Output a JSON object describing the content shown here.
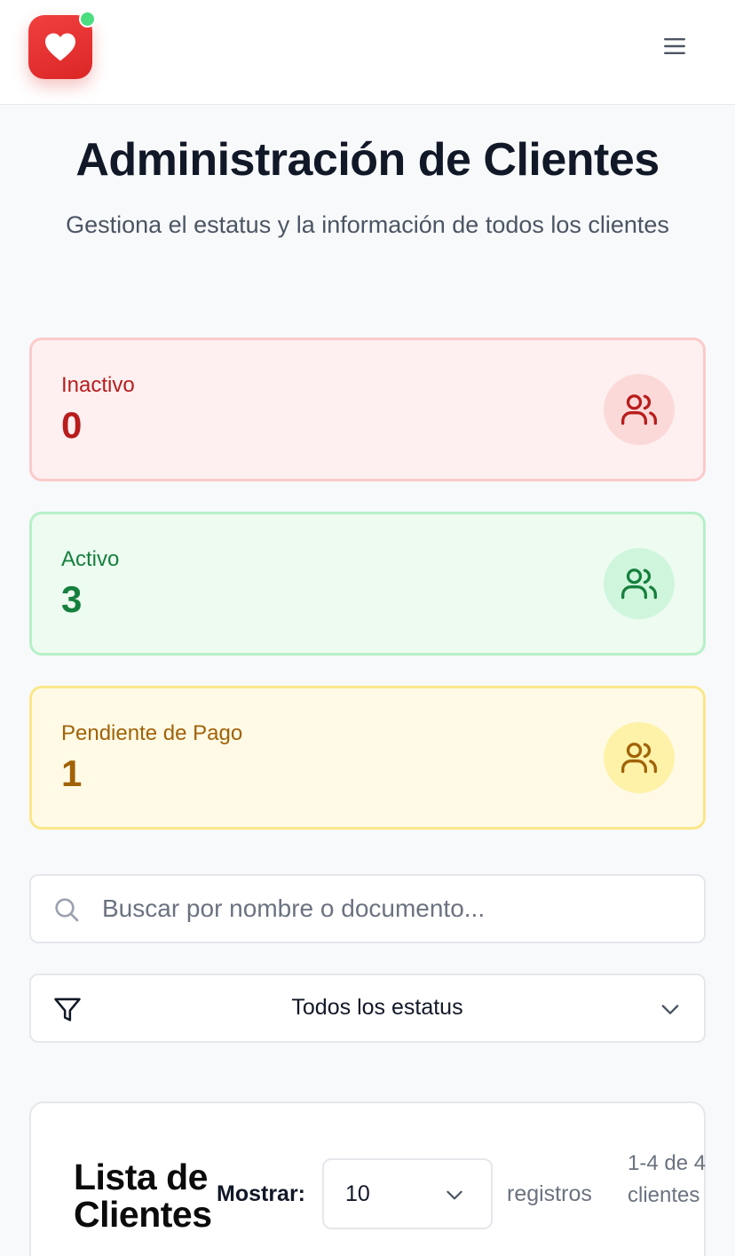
{
  "header": {
    "logo_icon": "heart-icon",
    "status_dot_color": "#4ade80",
    "menu_icon": "hamburger-menu-icon"
  },
  "page": {
    "title": "Administración de Clientes",
    "subtitle": "Gestiona el estatus y la información de todos los clientes"
  },
  "stats": [
    {
      "label": "Inactivo",
      "value": "0",
      "icon": "users-icon",
      "color": "#b91c1c"
    },
    {
      "label": "Activo",
      "value": "3",
      "icon": "users-icon",
      "color": "#15803d"
    },
    {
      "label": "Pendiente de Pago",
      "value": "1",
      "icon": "users-icon",
      "color": "#a16207"
    }
  ],
  "search": {
    "placeholder": "Buscar por nombre o documento...",
    "value": "",
    "icon": "search-icon"
  },
  "filter": {
    "selected": "Todos los estatus",
    "icon": "filter-icon"
  },
  "list": {
    "title": "Lista de Clientes",
    "show_label": "Mostrar:",
    "page_size": "10",
    "records_label": "registros",
    "range_label": "1-4 de 4 clientes"
  }
}
